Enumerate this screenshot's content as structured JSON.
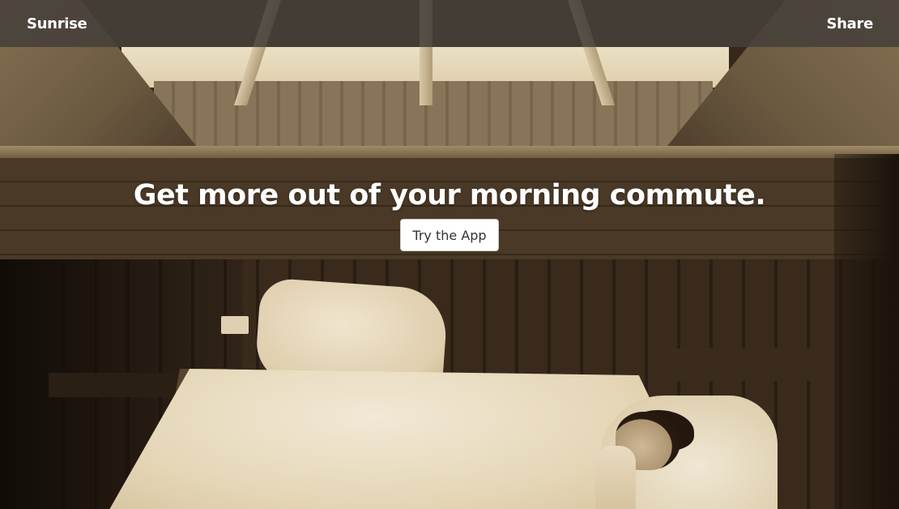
{
  "navbar": {
    "brand": "Sunrise",
    "share_label": "Share"
  },
  "hero": {
    "headline": "Get more out of your morning commute.",
    "cta_label": "Try the App"
  },
  "colors": {
    "navbar_bg": "#46403a",
    "text": "#ffffff",
    "button_bg": "#ffffff",
    "button_text": "#333333"
  }
}
